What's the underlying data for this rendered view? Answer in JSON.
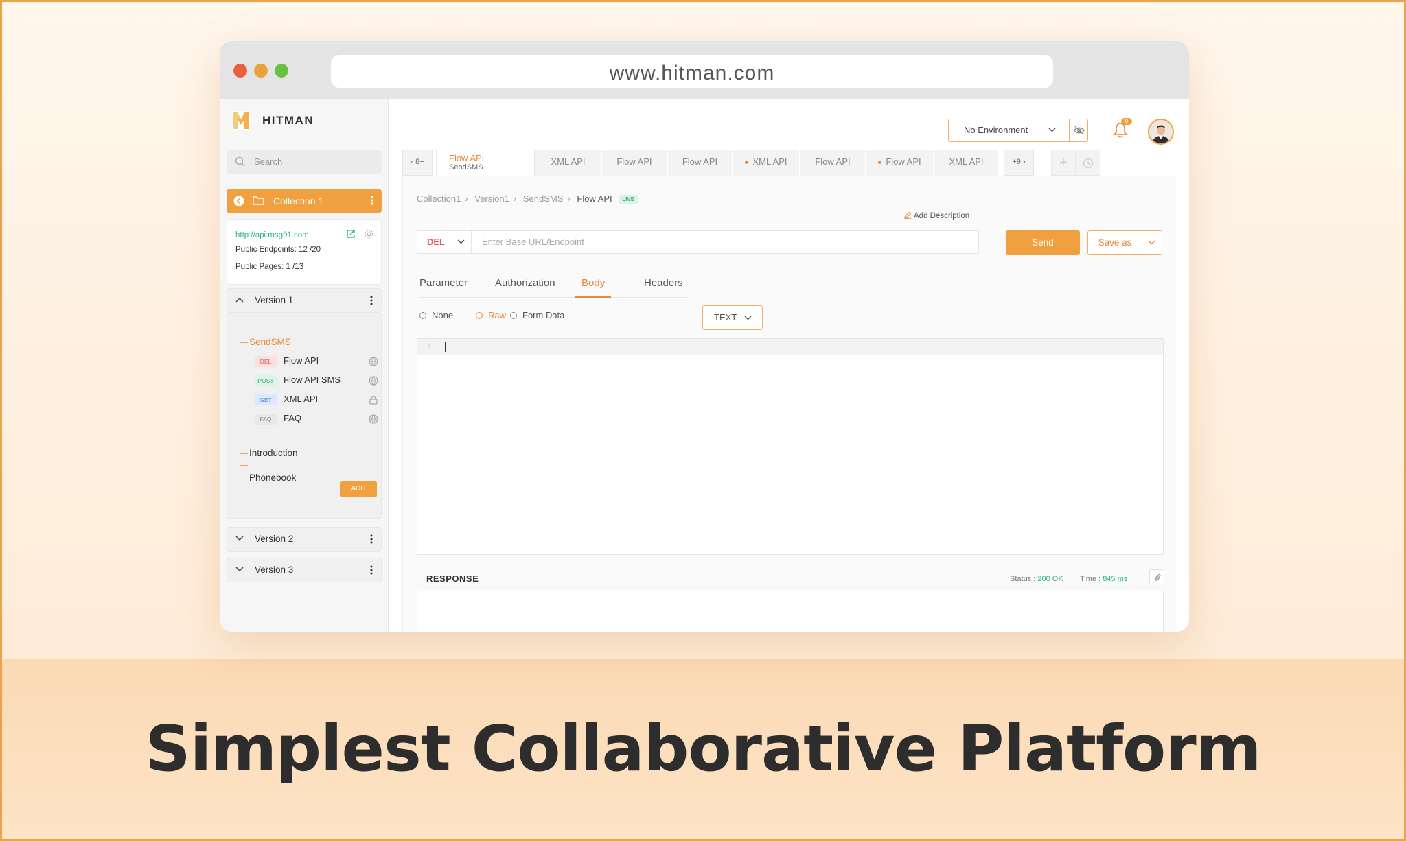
{
  "browser": {
    "url": "www.hitman.com"
  },
  "app": {
    "name": "Hitman"
  },
  "sidebar": {
    "search_placeholder": "Search",
    "collection": {
      "name": "Collection 1"
    },
    "info": {
      "base_url": "http://api.msg91.com....",
      "public_endpoints": "Public Endpoints: 12 /20",
      "public_pages": "Public Pages: 1 /13"
    },
    "versions": [
      {
        "label": "Version 1",
        "expanded": true
      },
      {
        "label": "Version 2",
        "expanded": false
      },
      {
        "label": "Version 3",
        "expanded": false
      }
    ],
    "tree": {
      "group": "SendSMS",
      "endpoints": [
        {
          "method": "DEL",
          "name": "Flow API",
          "icon": "globe-icon"
        },
        {
          "method": "POST",
          "name": "Flow API SMS",
          "icon": "globe-icon"
        },
        {
          "method": "GET",
          "name": "XML API",
          "icon": "lock-icon"
        },
        {
          "method": "FAQ",
          "name": "FAQ",
          "icon": "globe-icon"
        }
      ],
      "pages": [
        "Introduction",
        "Phonebook"
      ]
    },
    "add_label": "ADD"
  },
  "topbar": {
    "environment": "No Environment",
    "notification_count": "0"
  },
  "tabs": {
    "left_overflow": "8+",
    "right_overflow": "+9",
    "items": [
      {
        "label": "Flow API",
        "sub": "SendSMS",
        "active": true
      },
      {
        "label": "XML API",
        "modified": false
      },
      {
        "label": "Flow API",
        "modified": false
      },
      {
        "label": "Flow API",
        "modified": false
      },
      {
        "label": "XML API",
        "modified": true
      },
      {
        "label": "Flow API",
        "modified": false
      },
      {
        "label": "Flow API",
        "modified": true
      },
      {
        "label": "XML API",
        "modified": false
      }
    ]
  },
  "request": {
    "breadcrumb": [
      "Collection1",
      "Version1",
      "SendSMS",
      "Flow API"
    ],
    "live_badge": "LIVE",
    "add_description": "Add Description",
    "method": "DEL",
    "endpoint_placeholder": "Enter Base URL/Endpoint",
    "send_label": "Send",
    "save_as_label": "Save as",
    "tabs": [
      "Parameter",
      "Authorization",
      "Body",
      "Headers"
    ],
    "active_tab": "Body",
    "body_types": [
      "None",
      "Raw",
      "Form Data"
    ],
    "active_body_type": "Raw",
    "format": "TEXT",
    "line_number": "1"
  },
  "response": {
    "title": "RESPONSE",
    "status_label": "Status :",
    "status_value": "200 OK",
    "time_label": "Time :",
    "time_value": "845 ms"
  },
  "headline": "Simplest Collaborative Platform",
  "colors": {
    "accent": "#f0a03e",
    "success": "#2bb57b",
    "danger": "#e05a5a"
  }
}
